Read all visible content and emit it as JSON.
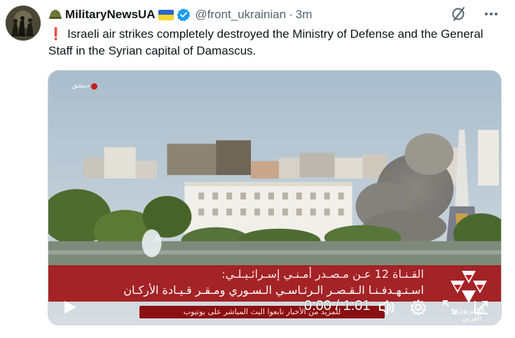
{
  "account": {
    "name": "MilitaryNewsUA",
    "handle": "@front_ukrainian",
    "separator": "·",
    "time": "3m",
    "flag_colors": [
      "#2a66c9",
      "#f7d52a"
    ],
    "verified_color": "#1d9bf0"
  },
  "tweet": {
    "icon": "red-exclamation-icon",
    "mark": "❗",
    "text": "Israeli air strikes completely destroyed the Ministry of Defense and the General Staff in the Syrian capital of Damascus."
  },
  "top_actions": [
    "grok-icon",
    "more-icon"
  ],
  "video": {
    "location_badge": "دمشق",
    "ticker_line1": "القـنـاة 12 عـن مـصـدر أمـنـي إسـرائـيـلـي:",
    "ticker_line2": "اسـتـهـدفـنـا الـقـصـر الـرئـاسـي الـسـوري ومـقـر قـيـادة الأركـان",
    "sub_line": "للمزيد من الأخبار تابعوا البث المباشر على يوتيوب",
    "channel_name": "التلفزيون العربي",
    "timecode": "0:00 / 1:01",
    "controls": [
      "play-icon",
      "volume-icon",
      "settings-icon",
      "fullscreen-icon",
      "logo-icon"
    ]
  }
}
